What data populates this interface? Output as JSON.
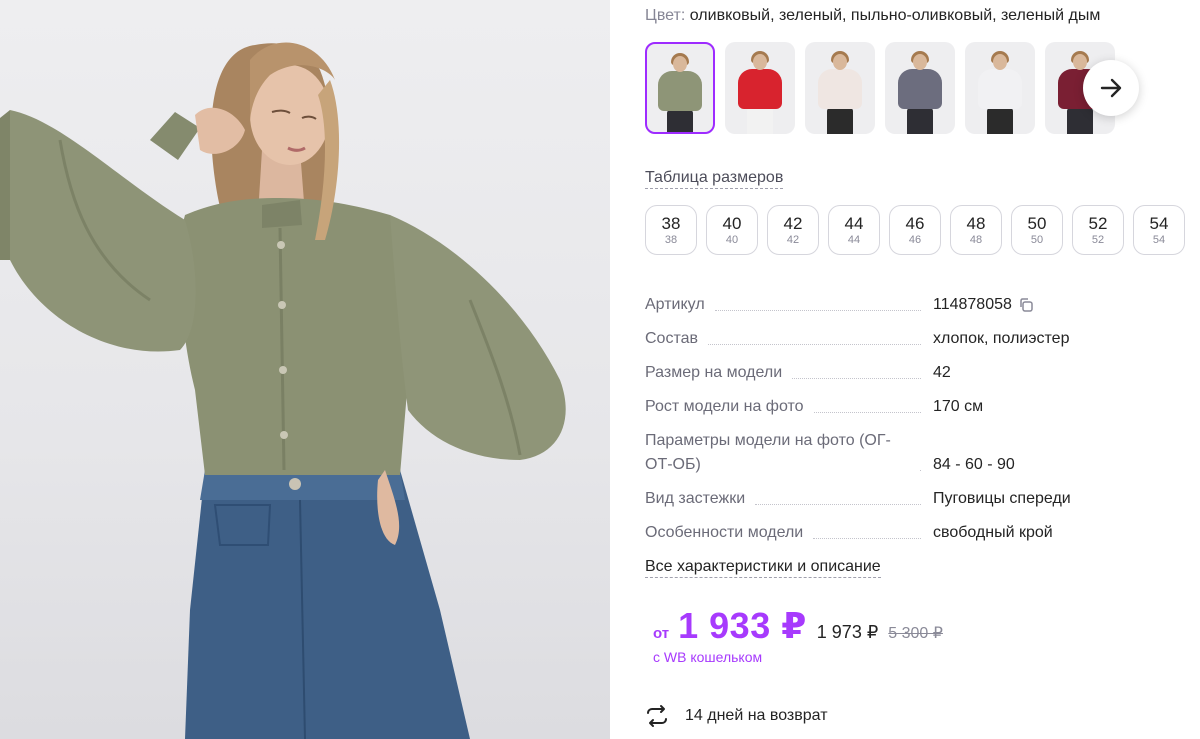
{
  "color": {
    "label": "Цвет:",
    "value": "оливковый, зеленый, пыльно-оливковый, зеленый дым"
  },
  "thumbnails": [
    {
      "color": "#8e9577",
      "selected": true
    },
    {
      "color": "#d8232e",
      "selected": false
    },
    {
      "color": "#efe6e2",
      "selected": false
    },
    {
      "color": "#6c6d7e",
      "selected": false
    },
    {
      "color": "#f1f1f3",
      "selected": false
    },
    {
      "color": "#7a1f33",
      "selected": false
    }
  ],
  "next_icon": "arrow-right-icon",
  "size_table_label": "Таблица размеров",
  "sizes": [
    {
      "main": "38",
      "sub": "38"
    },
    {
      "main": "40",
      "sub": "40"
    },
    {
      "main": "42",
      "sub": "42"
    },
    {
      "main": "44",
      "sub": "44"
    },
    {
      "main": "46",
      "sub": "46"
    },
    {
      "main": "48",
      "sub": "48"
    },
    {
      "main": "50",
      "sub": "50"
    },
    {
      "main": "52",
      "sub": "52"
    },
    {
      "main": "54",
      "sub": "54"
    }
  ],
  "params": [
    {
      "name": "Артикул",
      "value": "114878058"
    },
    {
      "name": "Состав",
      "value": "хлопок, полиэстер"
    },
    {
      "name": "Размер на модели",
      "value": "42"
    },
    {
      "name": "Рост модели на фото",
      "value": "170 см"
    },
    {
      "name": "Параметры модели на фото (ОГ-ОТ-ОБ)",
      "value": "84 - 60 - 90"
    },
    {
      "name": "Вид застежки",
      "value": "Пуговицы спереди"
    },
    {
      "name": "Особенности модели",
      "value": "свободный крой"
    }
  ],
  "all_specs_label": "Все характеристики и описание",
  "price": {
    "from": "от",
    "main": "1 933 ₽",
    "without_wallet": "1 973 ₽",
    "old": "5 300 ₽",
    "wallet_note": "с WB кошельком",
    "accent": "#a73afd"
  },
  "return_policy": {
    "icon": "exchange-arrows-icon",
    "text": "14 дней на возврат"
  }
}
